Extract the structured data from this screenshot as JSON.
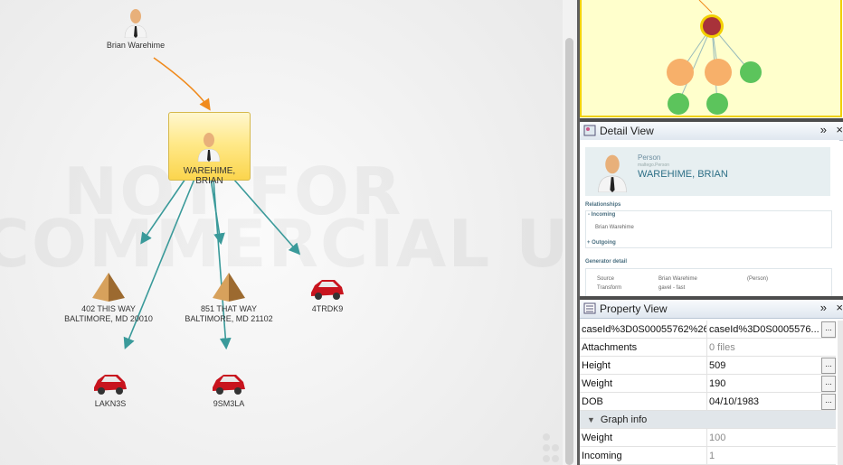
{
  "graph": {
    "watermark": [
      "NOT FOR",
      "COMMERCIAL USE"
    ],
    "nodes": {
      "top_person": "Brian Warehime",
      "selected_person": "WAREHIME, BRIAN",
      "address1_line1": "402 THIS WAY",
      "address1_line2": "BALTIMORE, MD 20010",
      "address2_line1": "851 THAT WAY",
      "address2_line2": "BALTIMORE, MD 21102",
      "vehicle1": "4TRDK9",
      "vehicle2": "LAKN3S",
      "vehicle3": "9SM3LA"
    },
    "colors": {
      "incoming_edge": "#f08a1c",
      "outgoing_edge": "#3a9a9a",
      "selected": "#ffe98a"
    }
  },
  "detail_view": {
    "title": "Detail View",
    "entity_type": "Person",
    "entity_subtype": "maltego.Person",
    "entity_name": "WAREHIME, BRIAN",
    "relationships_label": "Relationships",
    "incoming_label": "- Incoming",
    "incoming_item": "Brian Warehime",
    "outgoing_label": "+ Outgoing",
    "generator_label": "Generator detail",
    "source_label": "Source",
    "source_value": "Brian Warehime",
    "source_type": "(Person)",
    "transform_label": "Transform",
    "transform_value": "gavel - fast"
  },
  "property_view": {
    "title": "Property View",
    "rows": [
      {
        "key": "caseId%3D0S00055762%26",
        "value": "caseId%3D0S0005576...",
        "readonly": false
      },
      {
        "key": "Attachments",
        "value": "0 files",
        "readonly": true
      },
      {
        "key": "Height",
        "value": "509",
        "readonly": false
      },
      {
        "key": "Weight",
        "value": "190",
        "readonly": false
      },
      {
        "key": "DOB",
        "value": "04/10/1983",
        "readonly": false
      }
    ],
    "group_label": "Graph info",
    "group_rows": [
      {
        "key": "Weight",
        "value": "100"
      },
      {
        "key": "Incoming",
        "value": "1"
      }
    ],
    "more_button": "..."
  },
  "panel_controls": {
    "expand": "»",
    "close": "×"
  }
}
